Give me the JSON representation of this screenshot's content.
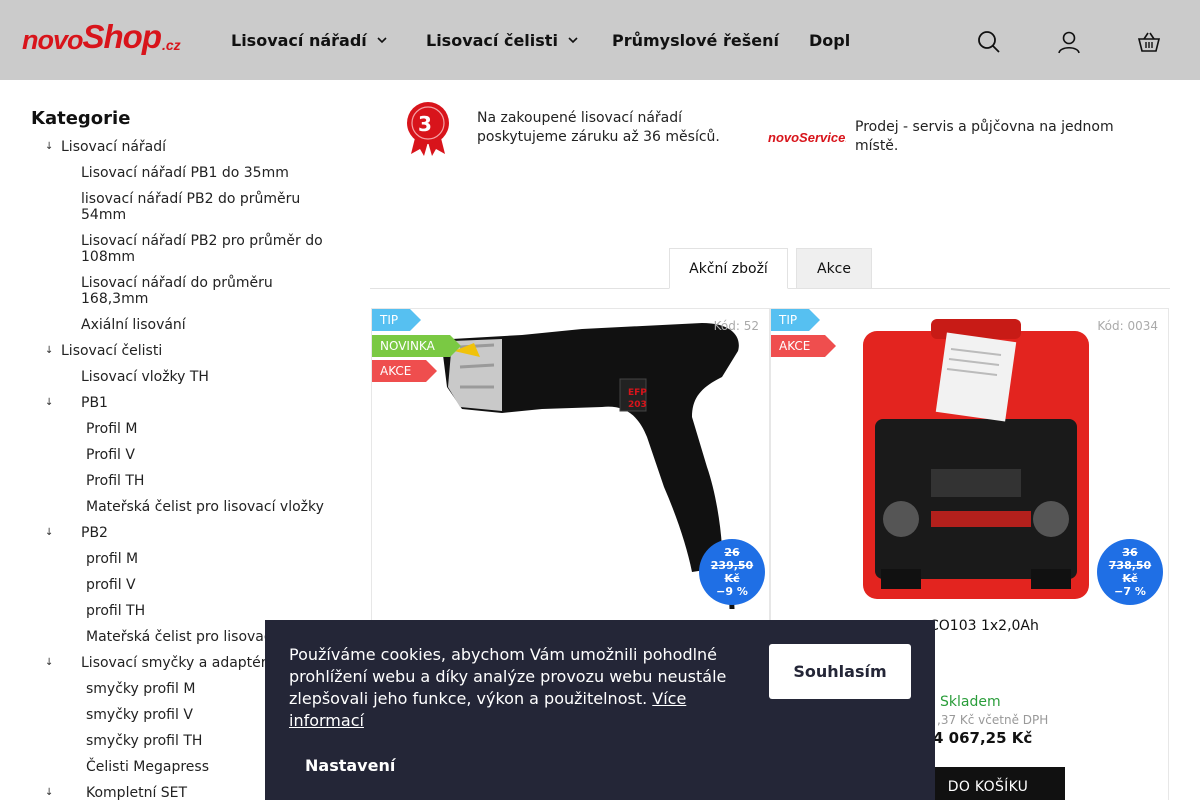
{
  "header": {
    "logo": {
      "part1": "novo",
      "part2": "Shop",
      "part3": ".cz"
    },
    "nav": [
      {
        "label": "Lisovací nářadí"
      },
      {
        "label": "Lisovací čelisti"
      },
      {
        "label": "Průmyslové řešení"
      },
      {
        "label": "Dopl"
      }
    ]
  },
  "sidebar": {
    "title": "Kategorie",
    "items": [
      {
        "label": "Lisovací nářadí",
        "arrow": "↓"
      },
      {
        "label": "Lisovací nářadí PB1 do 35mm"
      },
      {
        "label": "lisovací nářadí PB2 do průměru 54mm"
      },
      {
        "label": "Lisovací nářadí PB2 pro průměr do 108mm"
      },
      {
        "label": "Lisovací nářadí do průměru 168,3mm"
      },
      {
        "label": "Axiální lisování"
      },
      {
        "label": "Lisovací čelisti",
        "arrow": "↓"
      },
      {
        "label": "Lisovací vložky TH"
      },
      {
        "label": "PB1",
        "arrow": "↓"
      },
      {
        "label": "Profil M"
      },
      {
        "label": "Profil V"
      },
      {
        "label": "Profil TH"
      },
      {
        "label": "Mateřská čelist pro lisovací vložky"
      },
      {
        "label": "PB2",
        "arrow": "↓"
      },
      {
        "label": "profil M"
      },
      {
        "label": "profil V"
      },
      {
        "label": "profil TH"
      },
      {
        "label": "Mateřská čelist pro lisovací vložky"
      },
      {
        "label": "Lisovací smyčky a adaptéry",
        "arrow": "↓"
      },
      {
        "label": "smyčky profil M"
      },
      {
        "label": "smyčky profil V"
      },
      {
        "label": "smyčky profil TH"
      },
      {
        "label": "Čelisti Megapress"
      },
      {
        "label": "Kompletní SET",
        "arrow": "↓"
      }
    ]
  },
  "benefits": [
    {
      "badge": "3 YRS",
      "text": "Na zakoupené lisovací nářadí poskytujeme záruku až 36 měsíců."
    },
    {
      "logo": "novoService.cz",
      "text": "Prodej - servis a půjčovna na jednom místě."
    }
  ],
  "tabs": [
    {
      "label": "Akční zboží"
    },
    {
      "label": "Akce"
    }
  ],
  "products": [
    {
      "flags": [
        "TIP",
        "NOVINKA",
        "AKCE"
      ],
      "code": "Kód: 52",
      "discount_old_line1": "26",
      "discount_old_line2": "239,50",
      "discount_old_line3": "Kč",
      "discount_pct": "−9 %"
    },
    {
      "flags": [
        "TIP",
        "AKCE"
      ],
      "code": "Kód: 0034",
      "discount_old_line1": "36",
      "discount_old_line2": "738,50",
      "discount_old_line3": "Kč",
      "discount_pct": "−7 %",
      "name_visible": "CO103 1x2,0Ah",
      "stock": "Skladem",
      "vat_line": ",37 Kč včetně DPH",
      "price": "4 067,25 Kč",
      "cart_label": "DO KOŠÍKU"
    }
  ],
  "cookie": {
    "text": "Používáme cookies, abychom Vám umožnili pohodlné prohlížení webu a díky analýze provozu webu neustále zlepšovali jeho funkce, výkon a použitelnost.",
    "more": "Více informací",
    "agree": "Souhlasím",
    "settings": "Nastavení"
  },
  "colors": {
    "header_bg": "#cbcbcb",
    "brand_red": "#d8141b",
    "flag_tip": "#56c0f1",
    "flag_new": "#7ac943",
    "flag_sale": "#ef4e4e",
    "discount_blue": "#1f6fe5",
    "cookie_bg": "#242637"
  }
}
